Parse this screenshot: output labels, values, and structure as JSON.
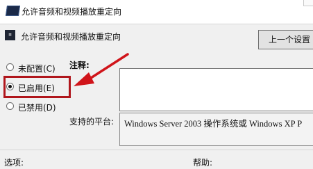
{
  "window": {
    "title": "允许音频和视频播放重定向"
  },
  "header": {
    "title": "允许音频和视频播放重定向",
    "prev_button": "上一个设置"
  },
  "options": [
    {
      "label": "未配置(C)",
      "checked": false
    },
    {
      "label": "已启用(E)",
      "checked": true
    },
    {
      "label": "已禁用(D)",
      "checked": false
    }
  ],
  "note": {
    "label": "注释:",
    "value": ""
  },
  "platform": {
    "label": "支持的平台:",
    "value": "Windows Server 2003 操作系统或 Windows XP P"
  },
  "footer": {
    "options_label": "选项:",
    "help_label": "帮助:"
  },
  "colors": {
    "highlight": "#b0161c",
    "arrow": "#d0141a"
  }
}
